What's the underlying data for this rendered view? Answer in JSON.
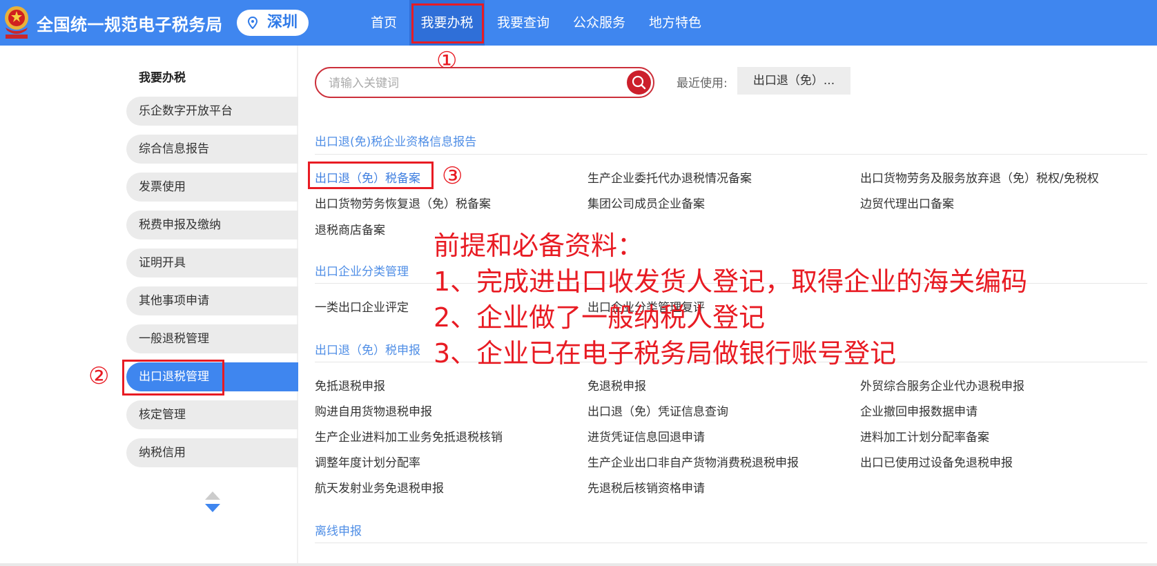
{
  "header": {
    "title": "全国统一规范电子税务局",
    "city": "深圳",
    "nav": [
      "首页",
      "我要办税",
      "我要查询",
      "公众服务",
      "地方特色"
    ]
  },
  "annotations": {
    "mark1": "①",
    "mark2": "②",
    "mark3": "③",
    "notes": [
      "前提和必备资料：",
      "1、完成进出口收发货人登记，取得企业的海关编码",
      "2、企业做了一般纳税人登记",
      "3、企业已在电子税务局做银行账号登记"
    ]
  },
  "sidebar": {
    "heading": "我要办税",
    "items": [
      "乐企数字开放平台",
      "综合信息报告",
      "发票使用",
      "税费申报及缴纳",
      "证明开具",
      "其他事项申请",
      "一般退税管理",
      "出口退税管理",
      "核定管理",
      "纳税信用"
    ],
    "active_index": 7
  },
  "search": {
    "placeholder": "请输入关键词",
    "recent_label": "最近使用:",
    "recent_item": "出口退（免）..."
  },
  "sections": [
    {
      "title": "出口退(免)税企业资格信息报告",
      "links": [
        "出口退（免）税备案",
        "生产企业委托代办退税情况备案",
        "出口货物劳务及服务放弃退（免）税权/免税权",
        "出口货物劳务恢复退（免）税备案",
        "集团公司成员企业备案",
        "边贸代理出口备案",
        "退税商店备案"
      ]
    },
    {
      "title": "出口企业分类管理",
      "links": [
        "一类出口企业评定",
        "出口企业分类管理复评"
      ]
    },
    {
      "title": "出口退（免）税申报",
      "links": [
        "免抵退税申报",
        "免退税申报",
        "外贸综合服务企业代办退税申报",
        "购进自用货物退税申报",
        "出口退（免）凭证信息查询",
        "企业撤回申报数据申请",
        "生产企业进料加工业务免抵退税核销",
        "进货凭证信息回退申请",
        "进料加工计划分配率备案",
        "调整年度计划分配率",
        "生产企业出口非自产货物消费税退税申报",
        "出口已使用过设备免退税申报",
        "航天发射业务免退税申报",
        "先退税后核销资格申请"
      ]
    },
    {
      "title": "离线申报",
      "links": []
    }
  ],
  "colors": {
    "header_bg": "#3f86ef",
    "accent_red": "#e81b23",
    "link_blue": "#4f8ee6"
  }
}
